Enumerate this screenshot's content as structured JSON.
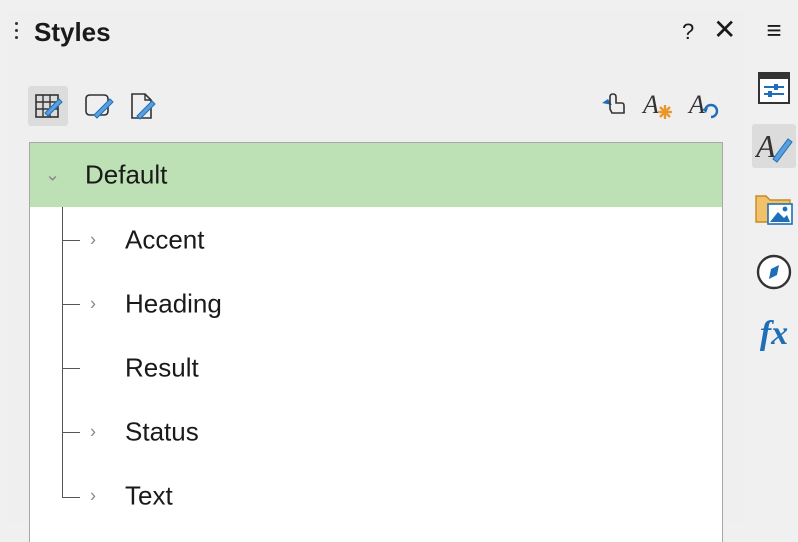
{
  "header": {
    "title": "Styles",
    "help_label": "?",
    "close_label": "✕"
  },
  "toolbar": {
    "left_buttons": [
      "paragraph-styles-icon",
      "character-styles-icon",
      "page-styles-icon"
    ],
    "right_buttons": [
      "fill-format-mode-icon",
      "new-style-from-selection-icon",
      "update-style-icon"
    ]
  },
  "tree": {
    "root": {
      "label": "Default",
      "expanded": true,
      "selected": true
    },
    "items": [
      {
        "label": "Accent",
        "has_children": true
      },
      {
        "label": "Heading",
        "has_children": true
      },
      {
        "label": "Result",
        "has_children": false
      },
      {
        "label": "Status",
        "has_children": true
      },
      {
        "label": "Text",
        "has_children": true
      }
    ]
  },
  "sidebar": {
    "menu_label": "≡",
    "fx_label": "fx",
    "tabs": [
      "properties-icon",
      "styles-icon",
      "gallery-icon",
      "navigator-icon",
      "functions-icon"
    ],
    "active_tab": "styles-icon"
  },
  "colors": {
    "selected_row": "#bde0b4",
    "accent_blue": "#1e6fb8",
    "accent_orange": "#e8962e"
  }
}
